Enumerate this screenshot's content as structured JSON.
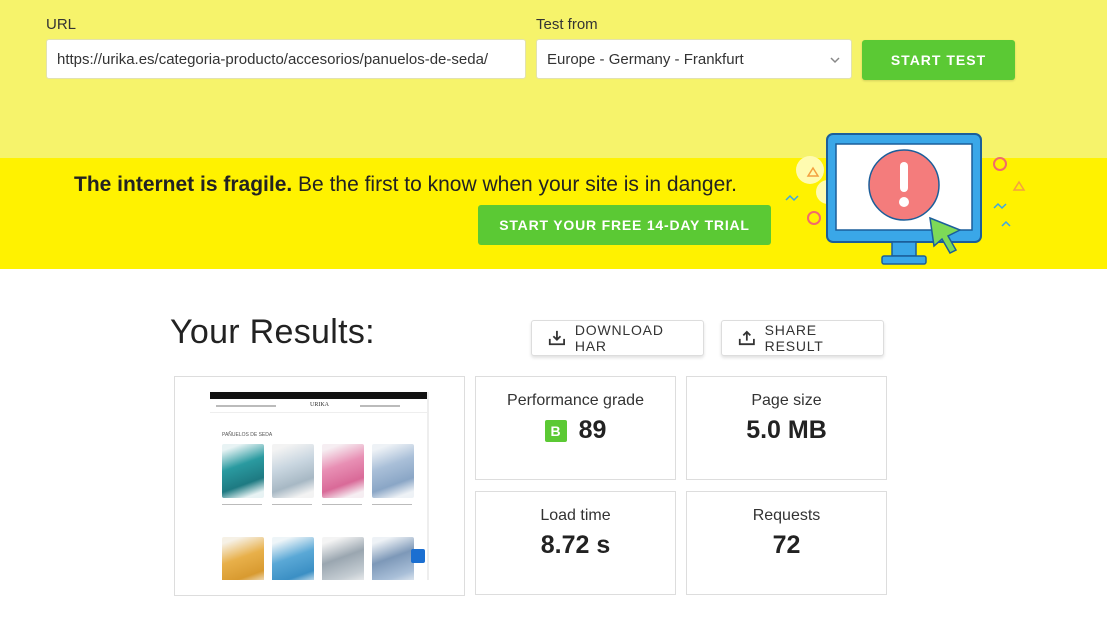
{
  "form": {
    "url_label": "URL",
    "url_value": "https://urika.es/categoria-producto/accesorios/panuelos-de-seda/",
    "from_label": "Test from",
    "location": "Europe - Germany - Frankfurt",
    "start_label": "START TEST"
  },
  "promo": {
    "bold": "The internet is fragile.",
    "rest": " Be the first to know when your site is in danger.",
    "trial_label": "START YOUR FREE 14-DAY TRIAL"
  },
  "results": {
    "title": "Your Results:",
    "download_label": "DOWNLOAD HAR",
    "share_label": "SHARE RESULT",
    "grade_label": "Performance grade",
    "grade_letter": "B",
    "grade_value": "89",
    "size_label": "Page size",
    "size_value": "5.0 MB",
    "load_label": "Load time",
    "load_value": "8.72 s",
    "req_label": "Requests",
    "req_value": "72"
  },
  "thumbnail": {
    "logo": "URIKA",
    "heading": "PAÑUELOS DE SEDA"
  },
  "colors": {
    "top_band": "#f6f36b",
    "promo_band": "#fff200",
    "accent_green": "#5bc934"
  },
  "icons": [
    "chevron-down-icon",
    "download-icon",
    "share-icon",
    "monitor-alert-icon",
    "chat-icon"
  ]
}
